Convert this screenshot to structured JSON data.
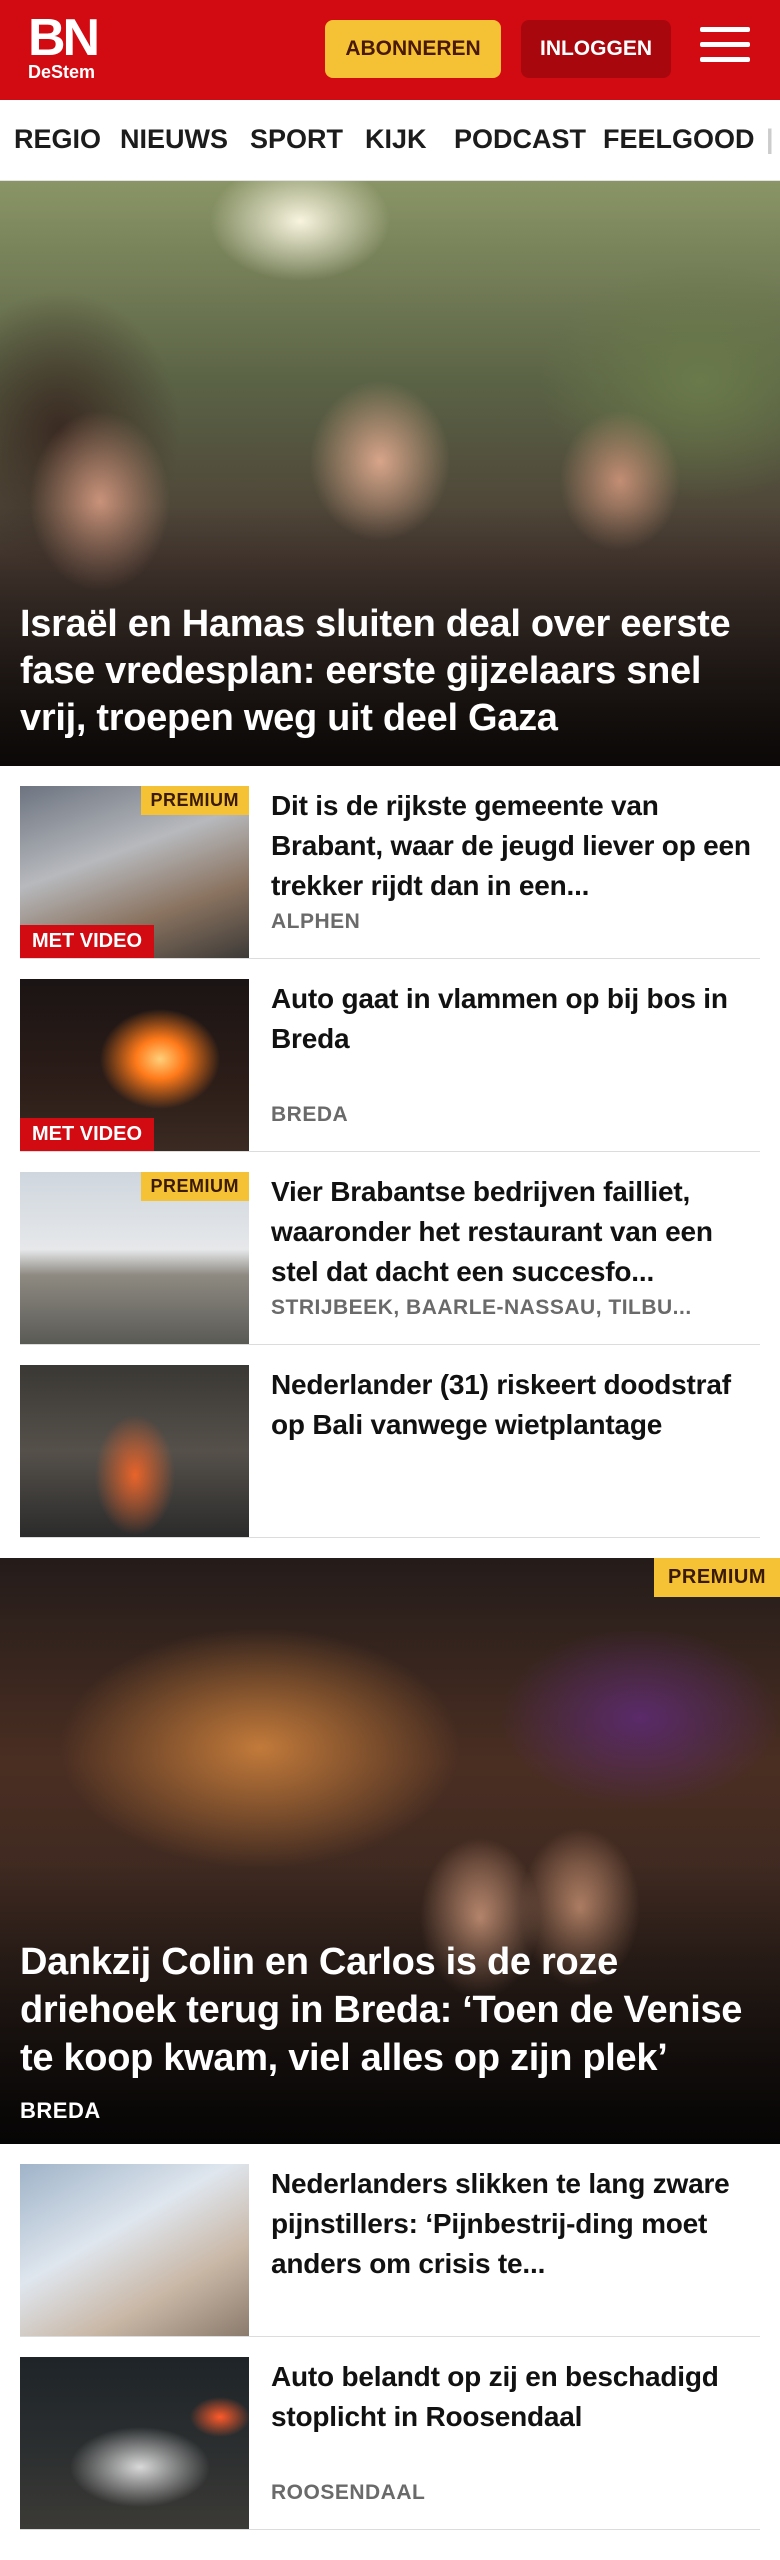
{
  "header": {
    "logo_main": "BN",
    "logo_sub": "DeStem",
    "subscribe_label": "ABONNEREN",
    "login_label": "INLOGGEN",
    "brand_color": "#d20a11",
    "accent_color": "#f6c235"
  },
  "nav": {
    "items": [
      "REGIO",
      "NIEUWS",
      "SPORT",
      "KIJK",
      "PODCAST",
      "FEELGOOD"
    ]
  },
  "hero": {
    "title": "Israël en Hamas sluiten deal over eerste fase vredesplan: eerste gijzelaars snel vrij, troepen weg uit deel Gaza"
  },
  "articles": [
    {
      "title": "Dit is de rijkste gemeente van Brabant, waar de jeugd liever op een trekker rijdt dan in een...",
      "place": "ALPHEN",
      "premium": "PREMIUM",
      "video": "MET VIDEO"
    },
    {
      "title": "Auto gaat in vlammen op bij bos in Breda",
      "place": "BREDA",
      "video": "MET VIDEO"
    },
    {
      "title": "Vier Brabantse bedrijven failliet, waaronder het restaurant van een stel dat dacht een succesfo...",
      "place": "STRIJBEEK, BAARLE-NASSAU, TILBU...",
      "premium": "PREMIUM"
    },
    {
      "title": "Nederlander (31) riskeert doodstraf op Bali vanwege wietplantage",
      "place": ""
    }
  ],
  "feature": {
    "title": "Dankzij Colin en Carlos is de roze driehoek terug in Breda: ‘Toen de Venise te koop kwam, viel alles op zijn plek’",
    "place": "BREDA",
    "premium": "PREMIUM"
  },
  "articles2": [
    {
      "title": "Nederlanders slikken te lang zware pijnstillers: ‘Pijnbestrij-ding moet anders om crisis te...",
      "place": ""
    },
    {
      "title": "Auto belandt op zij en beschadigd stoplicht in Roosendaal",
      "place": "ROOSENDAAL"
    }
  ]
}
